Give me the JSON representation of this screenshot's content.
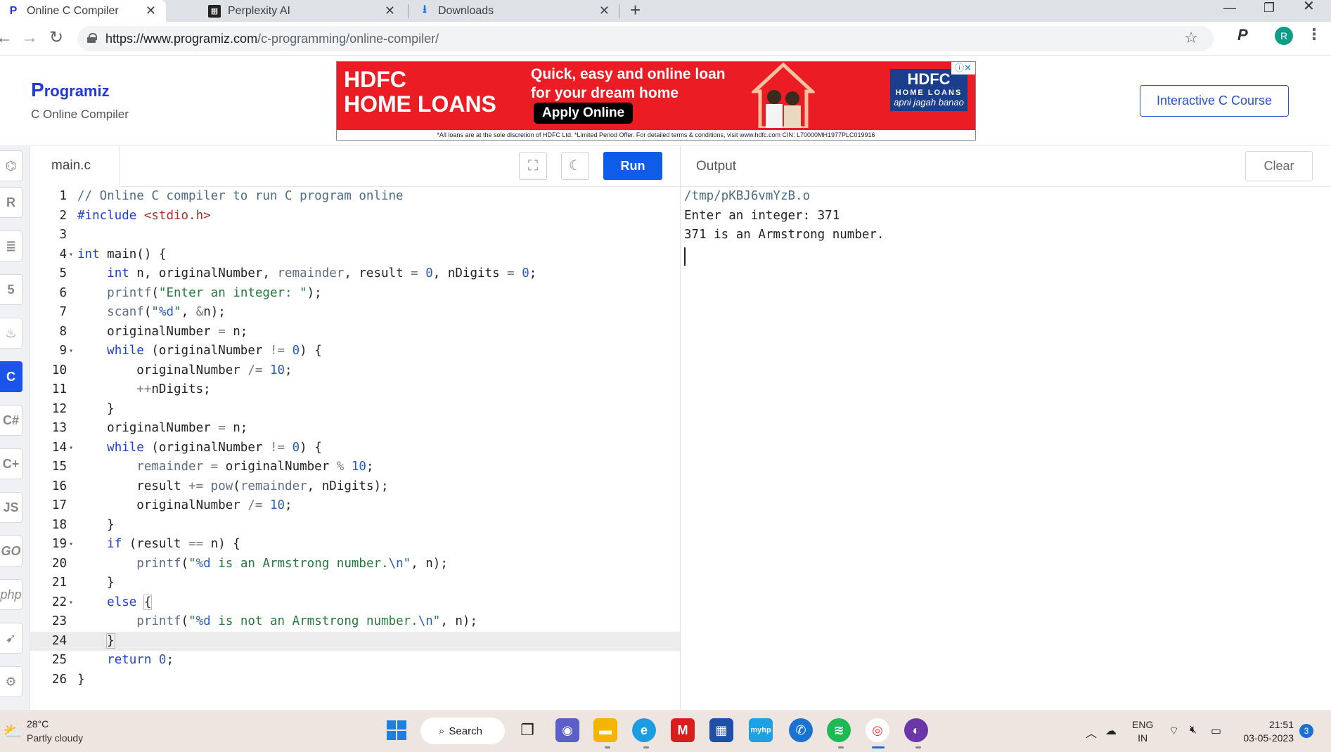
{
  "browser": {
    "tabs": [
      {
        "title": "Online C Compiler",
        "active": true
      },
      {
        "title": "Perplexity AI",
        "active": false
      },
      {
        "title": "Downloads",
        "active": false
      }
    ],
    "url_host": "https://www.programiz.com",
    "url_path": "/c-programming/online-compiler/",
    "profile_initial": "R"
  },
  "header": {
    "logo_text": "rogramiz",
    "logo_letter": "P",
    "subtitle": "C Online Compiler",
    "course_button": "Interactive C Course"
  },
  "ad": {
    "brand_line1": "HDFC",
    "brand_line2": "HOME LOANS",
    "tagline_1": "Quick, easy and online loan",
    "tagline_2": "for your dream home",
    "cta": "Apply Online",
    "logo_top": "HDFC",
    "logo_mid": "HOME LOANS",
    "logo_script": "apni jagah banao",
    "disclaimer": "*All loans are at the sole discretion of HDFC Ltd. *Limited Period Offer. For detailed terms & conditions, visit www.hdfc.com   CIN: L70000MH1977PLC019916"
  },
  "sidebar": {
    "items": [
      "python-icon",
      "r-icon",
      "sql-icon",
      "html5-icon",
      "java-icon",
      "c-icon",
      "csharp-icon",
      "cpp-icon",
      "js-icon",
      "go-icon",
      "php-icon",
      "swift-icon",
      "rust-icon"
    ],
    "labels": {
      "js": "JS",
      "go": "GO",
      "php": "php",
      "c": "C"
    }
  },
  "editor": {
    "file_name": "main.c",
    "run_label": "Run",
    "line_numbers": [
      "1",
      "2",
      "3",
      "4",
      "5",
      "6",
      "7",
      "8",
      "9",
      "10",
      "11",
      "12",
      "13",
      "14",
      "15",
      "16",
      "17",
      "18",
      "19",
      "20",
      "21",
      "22",
      "23",
      "24",
      "25",
      "26"
    ],
    "highlighted_line": 24,
    "foldable_lines": [
      4,
      9,
      14,
      19,
      22
    ]
  },
  "output": {
    "label": "Output",
    "clear_label": "Clear",
    "lines": [
      "/tmp/pKBJ6vmYzB.o",
      "Enter an integer: 371",
      "371 is an Armstrong number."
    ]
  },
  "taskbar": {
    "temperature": "28°C",
    "weather": "Partly cloudy",
    "search_label": "Search",
    "lang_1": "ENG",
    "lang_2": "IN",
    "time": "21:51",
    "date": "03-05-2023",
    "notifications": "3"
  },
  "colors": {
    "accent": "#0e5ce8",
    "brand": "#243ad6",
    "ad_red": "#ec1c24"
  }
}
